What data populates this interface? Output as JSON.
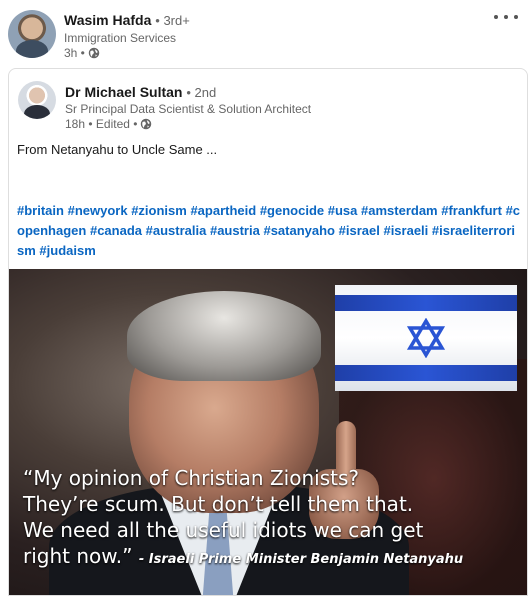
{
  "outer_post": {
    "author_name": "Wasim Hafda",
    "degree": "• 3rd+",
    "headline": "Immigration Services",
    "time": "3h •"
  },
  "inner_post": {
    "author_name": "Dr Michael Sultan",
    "degree": "• 2nd",
    "headline": "Sr Principal Data Scientist & Solution Architect",
    "time": "18h • Edited •",
    "text": "From Netanyahu to Uncle Same ...",
    "hashtags": [
      "#britain",
      "#newyork",
      "#zionism",
      "#apartheid",
      "#genocide",
      "#usa",
      "#amsterdam",
      "#frankfurt",
      "#copenhagen",
      "#canada",
      "#australia",
      "#austria",
      "#satanyaho",
      "#israel",
      "#israeli",
      "#israeliterrorism",
      "#judaism"
    ]
  },
  "image": {
    "quote_line1": "“My opinion of Christian Zionists?",
    "quote_line2": "They’re scum. But don’t tell them that.",
    "quote_line3": "We need all the useful idiots we can get",
    "quote_line4": "right now.”",
    "attribution": "- Israeli Prime Minister Benjamin Netanyahu"
  },
  "icons": {
    "visibility": "globe-icon",
    "more": "ellipsis-icon"
  },
  "colors": {
    "hashtag": "#0a66c2",
    "flag_blue": "#2a55d4"
  }
}
